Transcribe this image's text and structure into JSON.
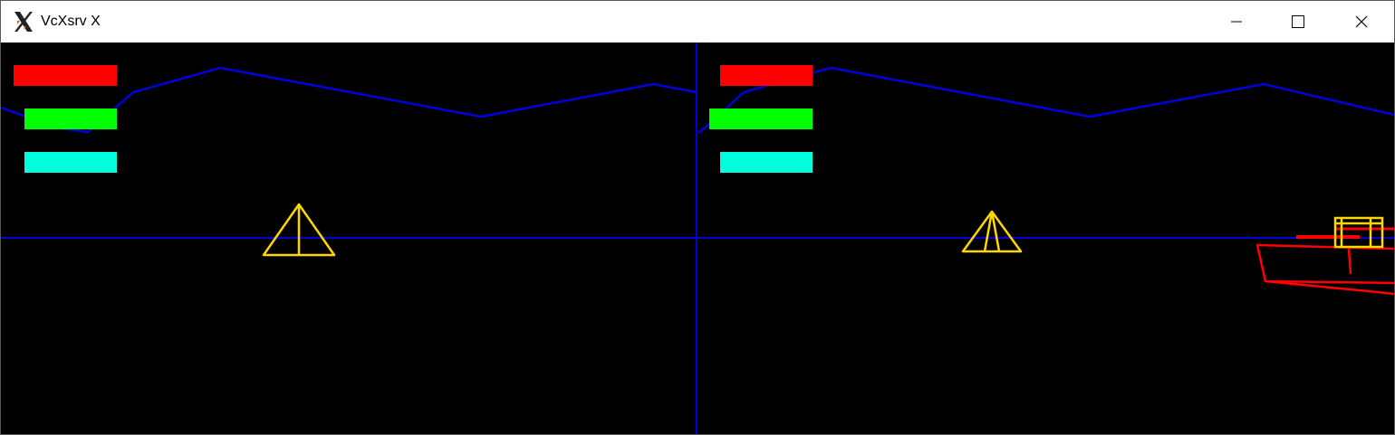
{
  "window": {
    "title": "VcXsrv X",
    "app_icon": "x-logo-icon",
    "controls": {
      "minimize_icon": "minimize-icon",
      "maximize_icon": "maximize-icon",
      "close_icon": "close-icon"
    }
  },
  "scene": {
    "background": "#000000",
    "colors": {
      "terrain": "#0000dd",
      "horizon": "#0000dd",
      "divider": "#0000dd",
      "bar_red": "#ff0000",
      "bar_green": "#00ff00",
      "bar_cyan": "#00ffdd",
      "pyramid": "#ffd700",
      "tank": "#ff0000",
      "target_box": "#ffd700"
    }
  }
}
